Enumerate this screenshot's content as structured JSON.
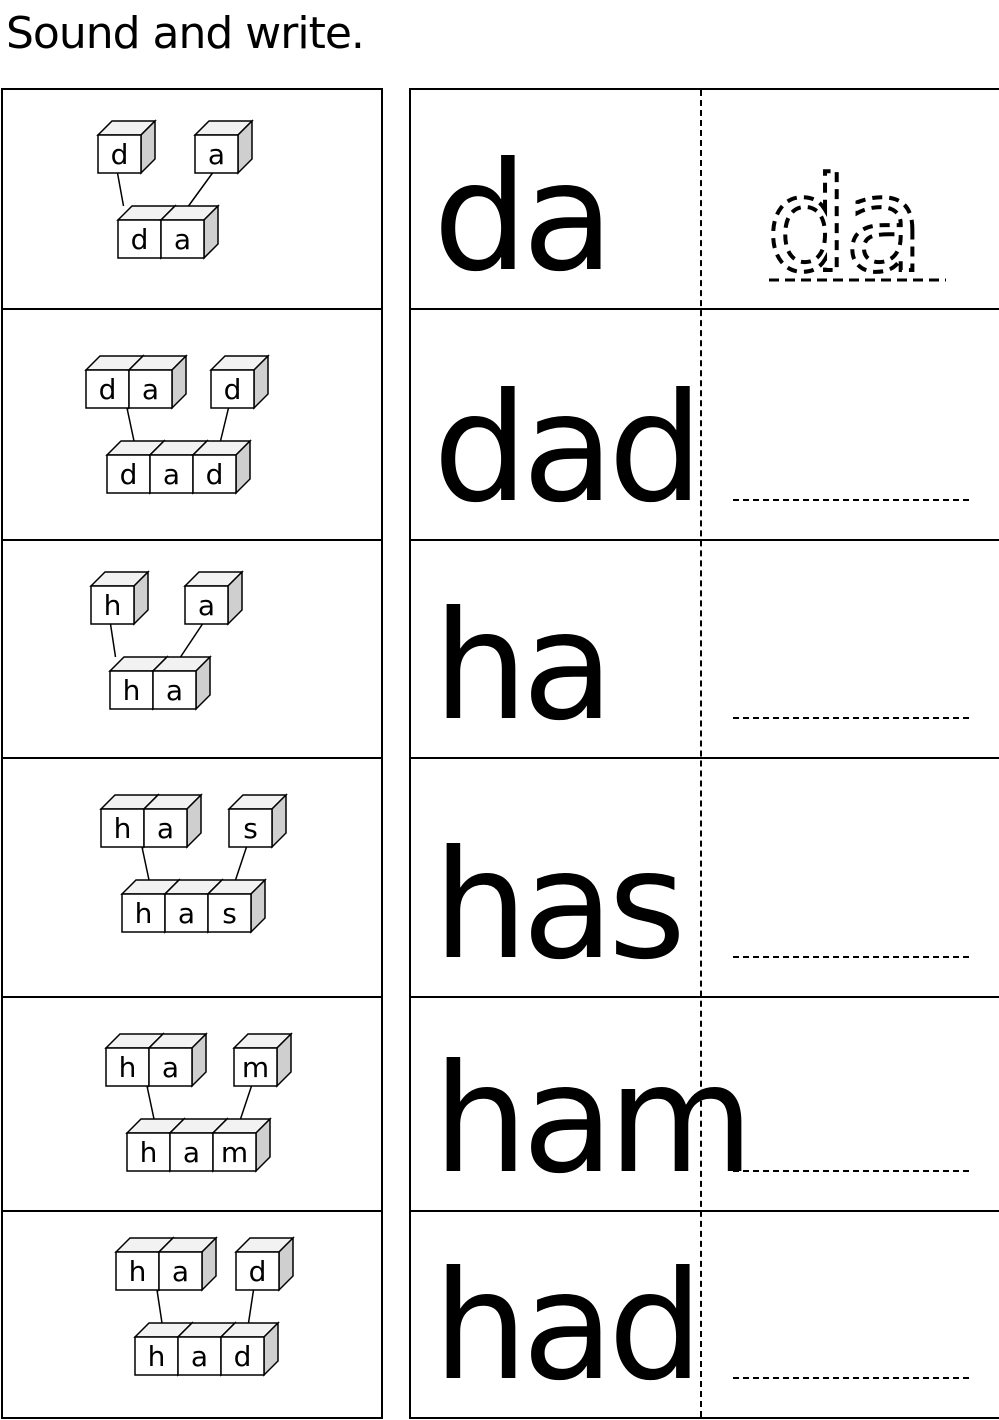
{
  "title": "Sound and write.",
  "rows": [
    {
      "word": "da",
      "parts": [
        "d",
        "a"
      ],
      "letters": [
        "d",
        "a"
      ]
    },
    {
      "word": "dad",
      "parts": [
        "da",
        "d"
      ],
      "letters": [
        "d",
        "a",
        "d"
      ]
    },
    {
      "word": "ha",
      "parts": [
        "h",
        "a"
      ],
      "letters": [
        "h",
        "a"
      ]
    },
    {
      "word": "has",
      "parts": [
        "ha",
        "s"
      ],
      "letters": [
        "h",
        "a",
        "s"
      ]
    },
    {
      "word": "ham",
      "parts": [
        "ha",
        "m"
      ],
      "letters": [
        "h",
        "a",
        "m"
      ]
    },
    {
      "word": "had",
      "parts": [
        "ha",
        "d"
      ],
      "letters": [
        "h",
        "a",
        "d"
      ]
    }
  ],
  "trace_example": "da"
}
